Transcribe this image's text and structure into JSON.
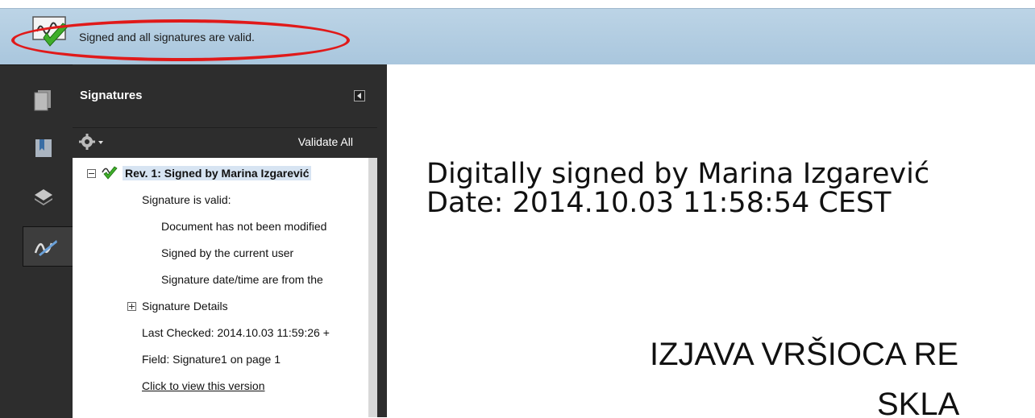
{
  "status_bar": {
    "message": "Signed and all signatures are valid."
  },
  "left_rail": {
    "icons": [
      "pages-icon",
      "bookmarks-icon",
      "layers-icon",
      "signatures-icon"
    ]
  },
  "signatures_panel": {
    "title": "Signatures",
    "validate_all": "Validate All",
    "tree": {
      "revision": "Rev. 1: Signed by Marina Izgarević",
      "status": "Signature is valid:",
      "details": [
        "Document has not been modified",
        "Signed by the current user",
        "Signature date/time are from the"
      ],
      "signature_details": "Signature Details",
      "last_checked": "Last Checked: 2014.10.03 11:59:26 +",
      "field": "Field: Signature1 on page 1",
      "view_version": "Click to view this version"
    }
  },
  "document": {
    "sig_line1": "Digitally signed by Marina Izgarević",
    "sig_line2": "Date: 2014.10.03 11:58:54 CEST",
    "heading_line1": "IZJAVA VRŠIOCA RE",
    "heading_line2": "SKLA"
  },
  "colors": {
    "highlight": "#e01a1a",
    "panel_bg": "#2d2d2d",
    "status_bar": "#b4cde2"
  }
}
